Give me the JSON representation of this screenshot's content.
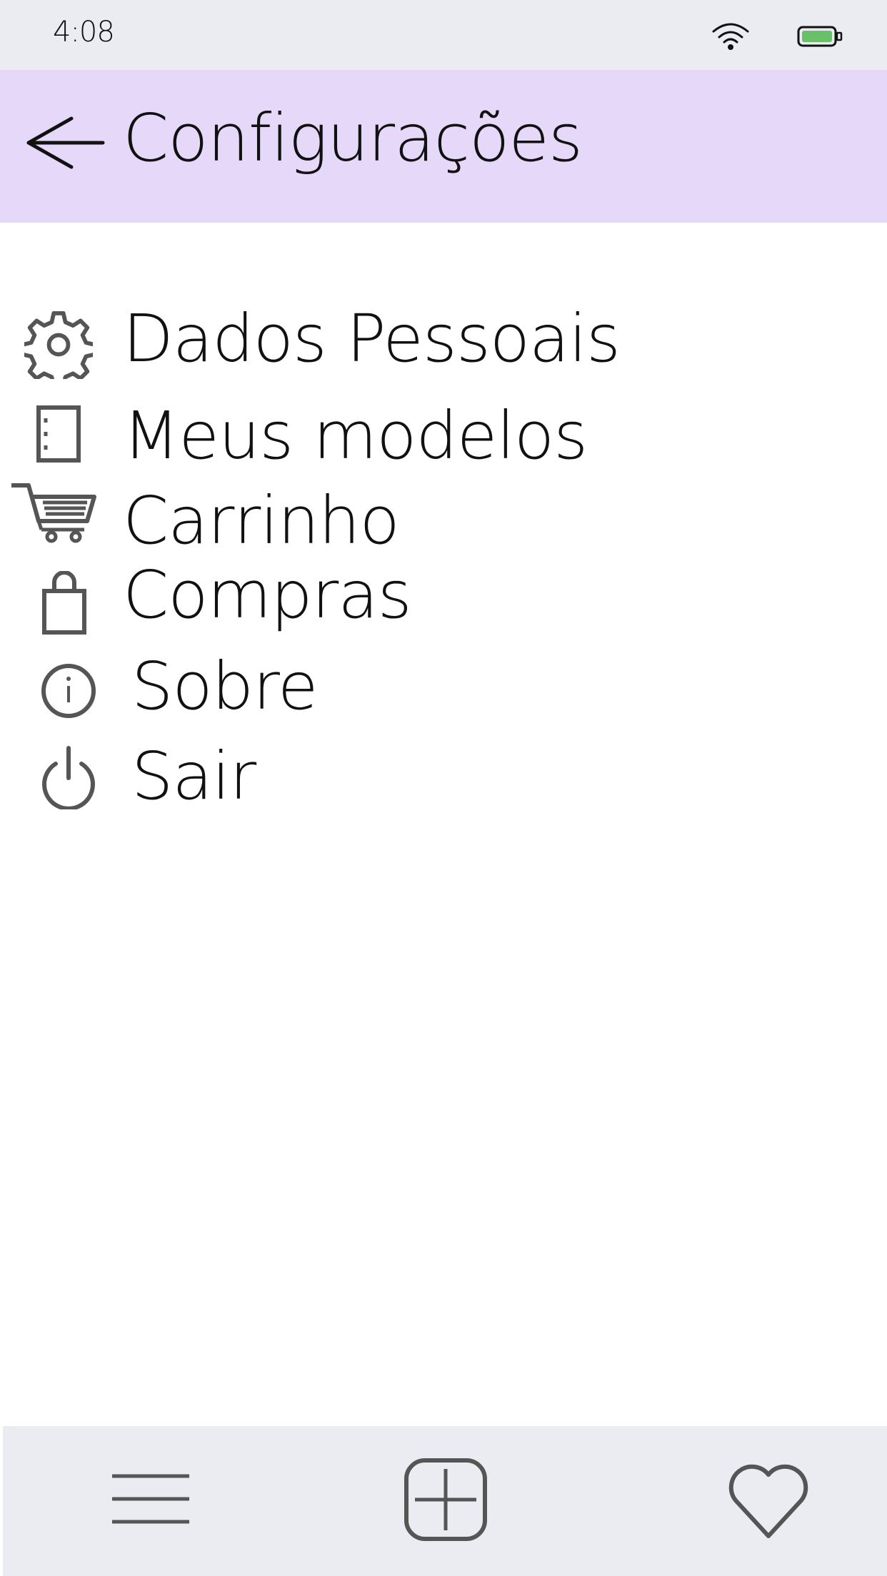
{
  "status_bar": {
    "time": "4:08",
    "icons": [
      "wifi-icon",
      "battery-icon"
    ],
    "battery_color": "#6abf69"
  },
  "header": {
    "title": "Configurações",
    "back_icon": "arrow-left-icon",
    "background": "#e5d8f8"
  },
  "menu": {
    "items": [
      {
        "label": "Dados Pessoais",
        "icon": "gear-icon"
      },
      {
        "label": "Meus modelos",
        "icon": "notebook-icon"
      },
      {
        "label": "Carrinho",
        "icon": "cart-icon"
      },
      {
        "label": "Compras",
        "icon": "shopping-bag-icon"
      },
      {
        "label": "Sobre",
        "icon": "info-icon"
      },
      {
        "label": "Sair",
        "icon": "power-icon"
      }
    ]
  },
  "bottom_nav": {
    "items": [
      "menu-icon",
      "add-icon",
      "heart-icon"
    ],
    "background": "#eaecf1"
  }
}
